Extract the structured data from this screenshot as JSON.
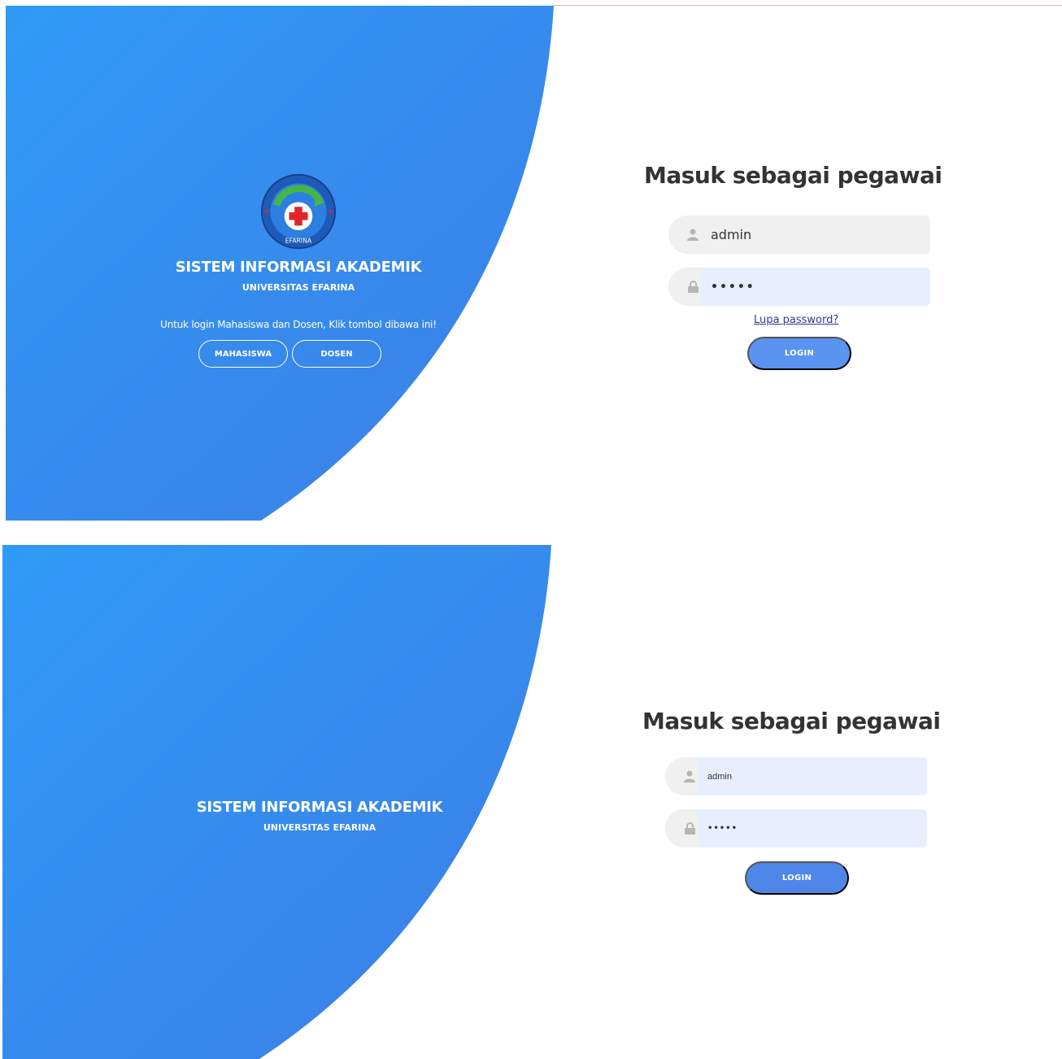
{
  "colors": {
    "gradient_start": "#2f9bf5",
    "gradient_end": "#3b7fe6",
    "login_button": "#5a93f0",
    "input_bg": "#f0f0f0",
    "input_autofill_bg": "#e7efff",
    "title_text": "#333333",
    "link": "#2b3a8c"
  },
  "screen1": {
    "logo": {
      "icon": "university-logo-icon",
      "ring_text": "EFARINA"
    },
    "app_title": "SISTEM INFORMASI AKADEMIK",
    "app_subtitle": "UNIVERSITAS EFARINA",
    "hint": "Untuk login Mahasiswa dan Dosen, Klik tombol dibawa ini!",
    "student_button": "MAHASISWA",
    "lecturer_button": "DOSEN",
    "form_title": "Masuk sebagai pegawai",
    "username": {
      "icon": "user-icon",
      "value": "admin"
    },
    "password": {
      "icon": "lock-icon",
      "value": "•••••"
    },
    "forgot_link": "Lupa password?",
    "login_button": "LOGIN"
  },
  "screen2": {
    "app_title": "SISTEM INFORMASI AKADEMIK",
    "app_subtitle": "UNIVERSITAS EFARINA",
    "form_title": "Masuk sebagai pegawai",
    "username": {
      "icon": "user-icon",
      "value": "admin"
    },
    "password": {
      "icon": "lock-icon",
      "value": "•••••"
    },
    "login_button": "LOGIN"
  }
}
